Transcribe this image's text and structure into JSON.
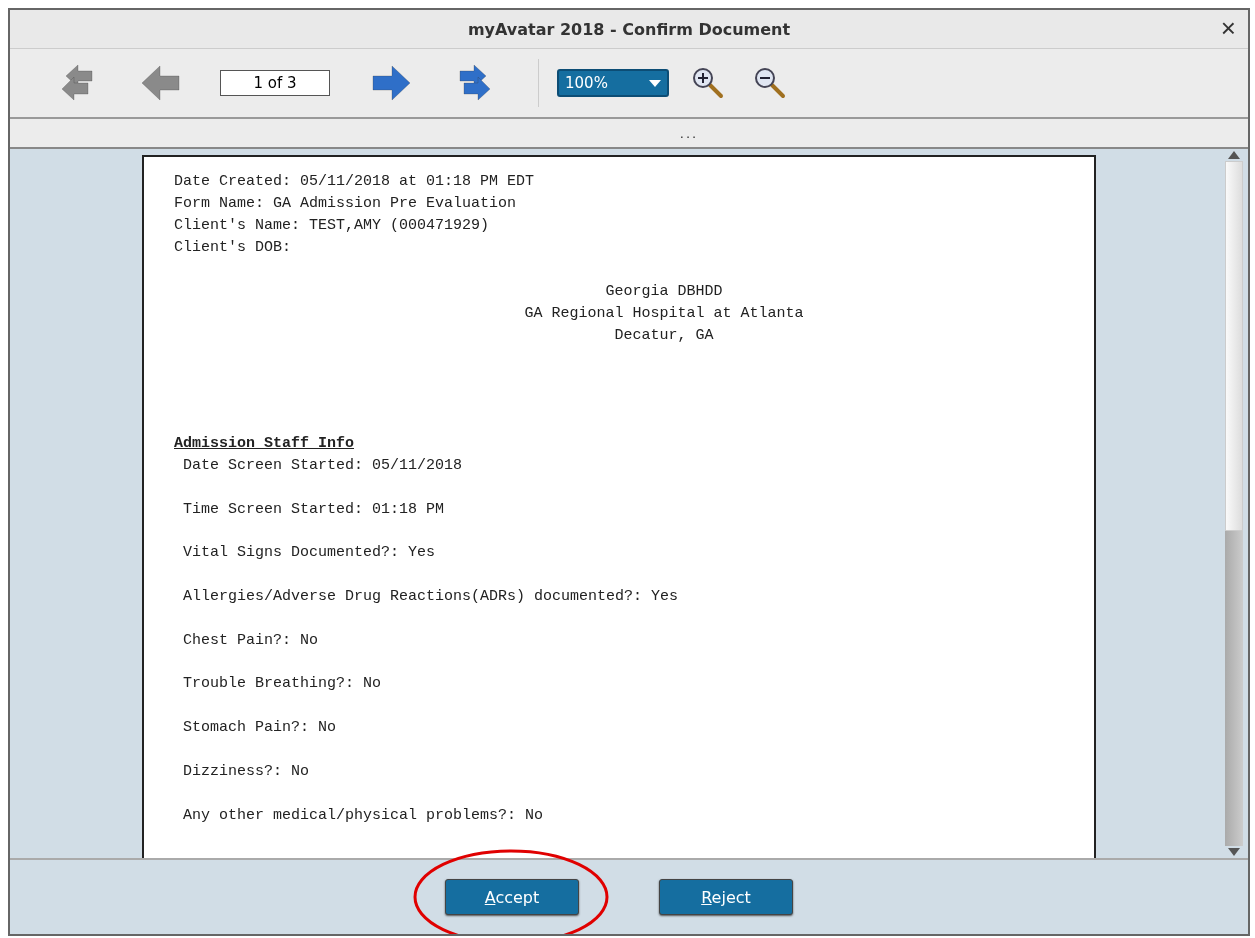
{
  "window": {
    "title": "myAvatar 2018 - Confirm Document",
    "close": "×"
  },
  "toolbar": {
    "nav": [
      {
        "kind": "first",
        "disabled": true
      },
      {
        "kind": "prev",
        "disabled": true
      },
      {
        "kind": "page",
        "value": "1 of 3"
      },
      {
        "kind": "next",
        "disabled": false
      },
      {
        "kind": "last",
        "disabled": false
      }
    ],
    "zoom": {
      "value": "100%"
    },
    "zoom_buttons": [
      {
        "kind": "in"
      },
      {
        "kind": "out"
      }
    ]
  },
  "splitter": {
    "label": "..."
  },
  "document": {
    "header_lines": [
      "Date Created: 05/11/2018 at 01:18 PM EDT",
      "Form Name: GA Admission Pre Evaluation",
      "Client's Name: TEST,AMY (000471929)",
      "Client's DOB:"
    ],
    "center_lines": [
      "Georgia DBHDD",
      "GA Regional Hospital at Atlanta",
      "Decatur, GA"
    ],
    "section_title": "Admission Staff Info",
    "fields": [
      "Date Screen Started: 05/11/2018",
      "Time Screen Started: 01:18 PM",
      "Vital Signs Documented?: Yes",
      "Allergies/Adverse Drug Reactions(ADRs) documented?: Yes",
      "Chest Pain?: No",
      "Trouble Breathing?: No",
      "Stomach Pain?: No",
      "Dizziness?: No",
      "Any other medical/physical problems?: No"
    ]
  },
  "buttons": [
    {
      "label": "Accept",
      "highlighted": true
    },
    {
      "label": "Reject",
      "highlighted": false
    }
  ]
}
